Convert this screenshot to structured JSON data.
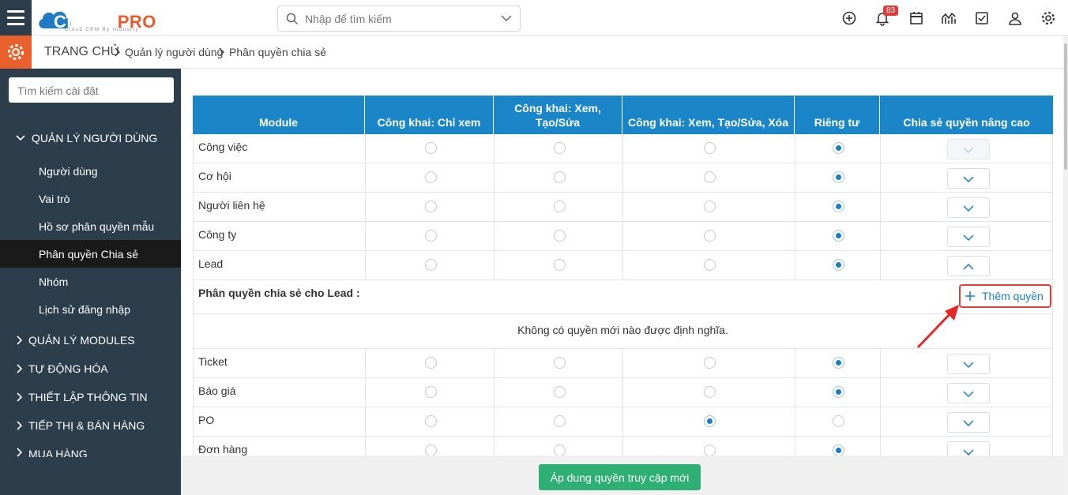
{
  "header": {
    "logo_text_1": "CLOUD",
    "logo_text_2": "PRO",
    "logo_sub": "Cloud CRM By Industry",
    "search_placeholder": "Nhập để tìm kiếm",
    "notification_count": "83"
  },
  "breadcrumb": {
    "home": "TRANG CHỦ",
    "level1": "Quản lý người dùng",
    "level2": "Phân quyền chia sẻ"
  },
  "sidebar": {
    "search_placeholder": "Tìm kiếm cài đặt",
    "section_user": "QUẢN LÝ NGƯỜI DÙNG",
    "items": [
      "Người dùng",
      "Vai trò",
      "Hồ sơ phân quyền mẫu",
      "Phân quyền Chia sẻ",
      "Nhóm",
      "Lịch sử đăng nhập"
    ],
    "sections": [
      "QUẢN LÝ MODULES",
      "TỰ ĐỘNG HÓA",
      "THIẾT LẬP THÔNG TIN",
      "TIẾP THỊ & BÁN HÀNG",
      "MUA HÀNG"
    ]
  },
  "table": {
    "headers": [
      "Module",
      "Công khai: Chỉ xem",
      "Công khai: Xem, Tạo/Sửa",
      "Công khai: Xem, Tạo/Sửa, Xóa",
      "Riêng tư",
      "Chia sẻ quyền nâng cao"
    ],
    "rows_top": [
      {
        "module": "Công việc",
        "selected": 3,
        "button": "down-disabled"
      },
      {
        "module": "Cơ hội",
        "selected": 3,
        "button": "down"
      },
      {
        "module": "Người liên hệ",
        "selected": 3,
        "button": "down"
      },
      {
        "module": "Công ty",
        "selected": 3,
        "button": "down"
      },
      {
        "module": "Lead",
        "selected": 3,
        "button": "up"
      }
    ],
    "lead_share_title": "Phân quyền chia sẻ cho Lead :",
    "add_permission": "Thêm quyền",
    "lead_empty": "Không có quyền mới nào được định nghĩa.",
    "rows_bottom": [
      {
        "module": "Ticket",
        "selected": 3,
        "button": "down"
      },
      {
        "module": "Báo giá",
        "selected": 3,
        "button": "down"
      },
      {
        "module": "PO",
        "selected": 2,
        "button": "down"
      },
      {
        "module": "Đơn hàng",
        "selected": 3,
        "button": "down"
      }
    ]
  },
  "footer": {
    "apply_label": "Áp dung quyền truy cập mới"
  },
  "colors": {
    "header_blue": "#1a86c8",
    "sidebar_bg": "#2c3d4c",
    "accent_orange": "#e8602c",
    "apply_green": "#2eaf73",
    "highlight_red": "#e23b3b"
  }
}
